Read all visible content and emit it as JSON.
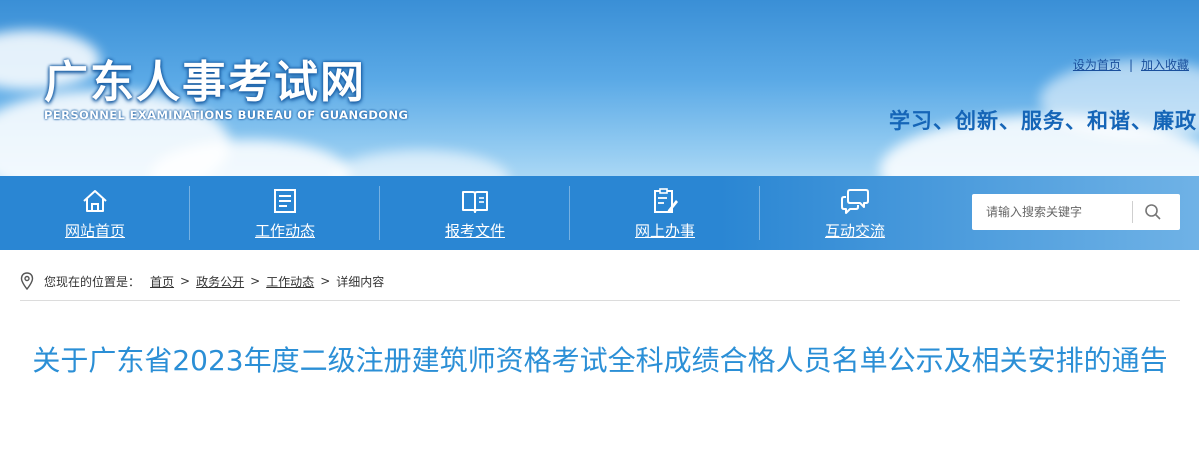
{
  "header": {
    "site_title": "广东人事考试网",
    "site_subtitle": "PERSONNEL EXAMINATIONS BUREAU OF GUANGDONG",
    "top_links": [
      "设为首页",
      "加入收藏"
    ],
    "slogan": "学习、创新、服务、和谐、廉政"
  },
  "nav": {
    "items": [
      {
        "label": "网站首页",
        "icon": "home-icon"
      },
      {
        "label": "工作动态",
        "icon": "news-list-icon"
      },
      {
        "label": "报考文件",
        "icon": "book-icon"
      },
      {
        "label": "网上办事",
        "icon": "clipboard-edit-icon"
      },
      {
        "label": "互动交流",
        "icon": "chat-bubbles-icon"
      }
    ]
  },
  "search": {
    "placeholder": "请输入搜索关键字",
    "icon": "search-icon"
  },
  "breadcrumb": {
    "prefix": "您现在的位置是：",
    "items": [
      "首页",
      "政务公开",
      "工作动态"
    ],
    "current": "详细内容"
  },
  "article": {
    "title": "关于广东省2023年度二级注册建筑师资格考试全科成绩合格人员名单公示及相关安排的通告"
  },
  "colors": {
    "nav_bg": "#2a86d3",
    "title_blue": "#2b8fd6",
    "slogan_blue": "#1565b7"
  }
}
